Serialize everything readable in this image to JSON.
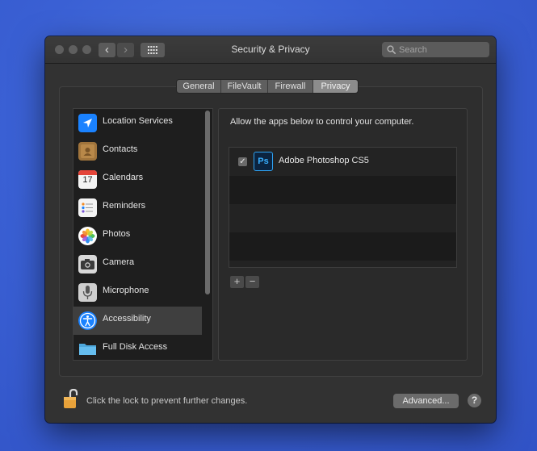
{
  "window": {
    "title": "Security & Privacy",
    "back_glyph": "‹",
    "forward_glyph": "›"
  },
  "search": {
    "placeholder": "Search",
    "value": ""
  },
  "tabs": [
    {
      "label": "General",
      "active": false
    },
    {
      "label": "FileVault",
      "active": false
    },
    {
      "label": "Firewall",
      "active": false
    },
    {
      "label": "Privacy",
      "active": true
    }
  ],
  "sidebar": {
    "items": [
      {
        "label": "Location Services",
        "icon": "location-arrow-icon",
        "selected": false
      },
      {
        "label": "Contacts",
        "icon": "contacts-book-icon",
        "selected": false
      },
      {
        "label": "Calendars",
        "icon": "calendar-icon",
        "selected": false,
        "icon_text": "17"
      },
      {
        "label": "Reminders",
        "icon": "reminders-list-icon",
        "selected": false
      },
      {
        "label": "Photos",
        "icon": "photos-flower-icon",
        "selected": false
      },
      {
        "label": "Camera",
        "icon": "camera-icon",
        "selected": false
      },
      {
        "label": "Microphone",
        "icon": "microphone-icon",
        "selected": false
      },
      {
        "label": "Accessibility",
        "icon": "accessibility-icon",
        "selected": true
      },
      {
        "label": "Full Disk Access",
        "icon": "folder-icon",
        "selected": false
      }
    ]
  },
  "main": {
    "prompt": "Allow the apps below to control your computer.",
    "apps": [
      {
        "name": "Adobe Photoshop CS5",
        "icon_text": "Ps",
        "checked": true,
        "check_glyph": "✓"
      }
    ],
    "add_glyph": "+",
    "remove_glyph": "−"
  },
  "footer": {
    "lock_text": "Click the lock to prevent further changes.",
    "advanced_label": "Advanced...",
    "help_label": "?"
  },
  "colors": {
    "desktop_blue": "#3a60d4",
    "window_bg": "#323232",
    "accent_blue": "#1a82ff",
    "lock_orange": "#e8a23a"
  }
}
